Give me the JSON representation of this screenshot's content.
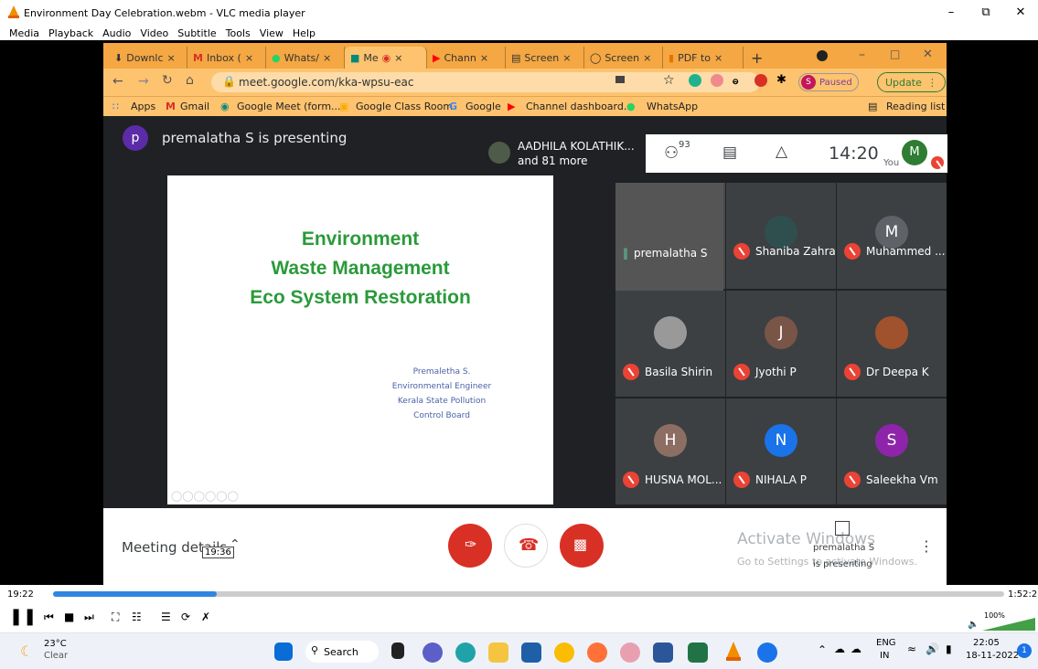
{
  "vlc": {
    "title": "Environment Day Celebration.webm - VLC media player",
    "menu": [
      "Media",
      "Playback",
      "Audio",
      "Video",
      "Subtitle",
      "Tools",
      "View",
      "Help"
    ],
    "time_current": "19:22",
    "time_total": "1:52:20",
    "tooltip_time": "19:36",
    "volume": "100%",
    "progress": 0.172
  },
  "browser": {
    "tabs": [
      "Downlc",
      "Inbox (",
      "Whats/",
      "Me",
      "Chann",
      "Screen",
      "Screen",
      "PDF to"
    ],
    "url": "meet.google.com/kka-wpsu-eac",
    "paused": "Paused",
    "update": "Update",
    "bookmarks": [
      "Apps",
      "Gmail",
      "Google Meet (form...",
      "Google Class Room",
      "Google",
      "Channel dashboard...",
      "WhatsApp"
    ],
    "reading_list": "Reading list"
  },
  "meet": {
    "presenter_initial": "p",
    "presenter_text": "premalatha S is presenting",
    "others_name": "AADHILA KOLATHIK...",
    "others_more": "and 81 more",
    "participant_count": "93",
    "clock": "14:20",
    "you_label": "You",
    "you_initial": "M",
    "meeting_details": "Meeting details",
    "activate1": "Activate Windows",
    "activate2": "Go to Settings to activate Windows.",
    "present_note1": "premalatha S",
    "present_note2": "is presenting"
  },
  "slide": {
    "line1": "Environment",
    "line2": "Waste Management",
    "line3": "Eco System Restoration",
    "sub1": "Premaletha S.",
    "sub2": "Environmental Engineer",
    "sub3": "Kerala State Pollution",
    "sub4": "Control Board"
  },
  "participants": [
    {
      "name": "premalatha S",
      "initial": "",
      "color": "#6b6b6b"
    },
    {
      "name": "Shaniba Zahra",
      "initial": "",
      "color": "#3a4a4a"
    },
    {
      "name": "Muhammed ...",
      "initial": "M",
      "color": "#5f6368"
    },
    {
      "name": "Basila Shirin",
      "initial": "",
      "color": "#888"
    },
    {
      "name": "Jyothi P",
      "initial": "J",
      "color": "#795548"
    },
    {
      "name": "Dr Deepa K",
      "initial": "",
      "color": "#a0522d"
    },
    {
      "name": "HUSNA MOL...",
      "initial": "H",
      "color": "#8d6e63"
    },
    {
      "name": "NIHALA P",
      "initial": "N",
      "color": "#1a73e8"
    },
    {
      "name": "Saleekha Vm",
      "initial": "S",
      "color": "#8e24aa"
    }
  ],
  "taskbar": {
    "temp": "23°C",
    "weather": "Clear",
    "search": "Search",
    "lang1": "ENG",
    "lang2": "IN",
    "time": "22:05",
    "date": "18-11-2022",
    "notif": "1"
  }
}
